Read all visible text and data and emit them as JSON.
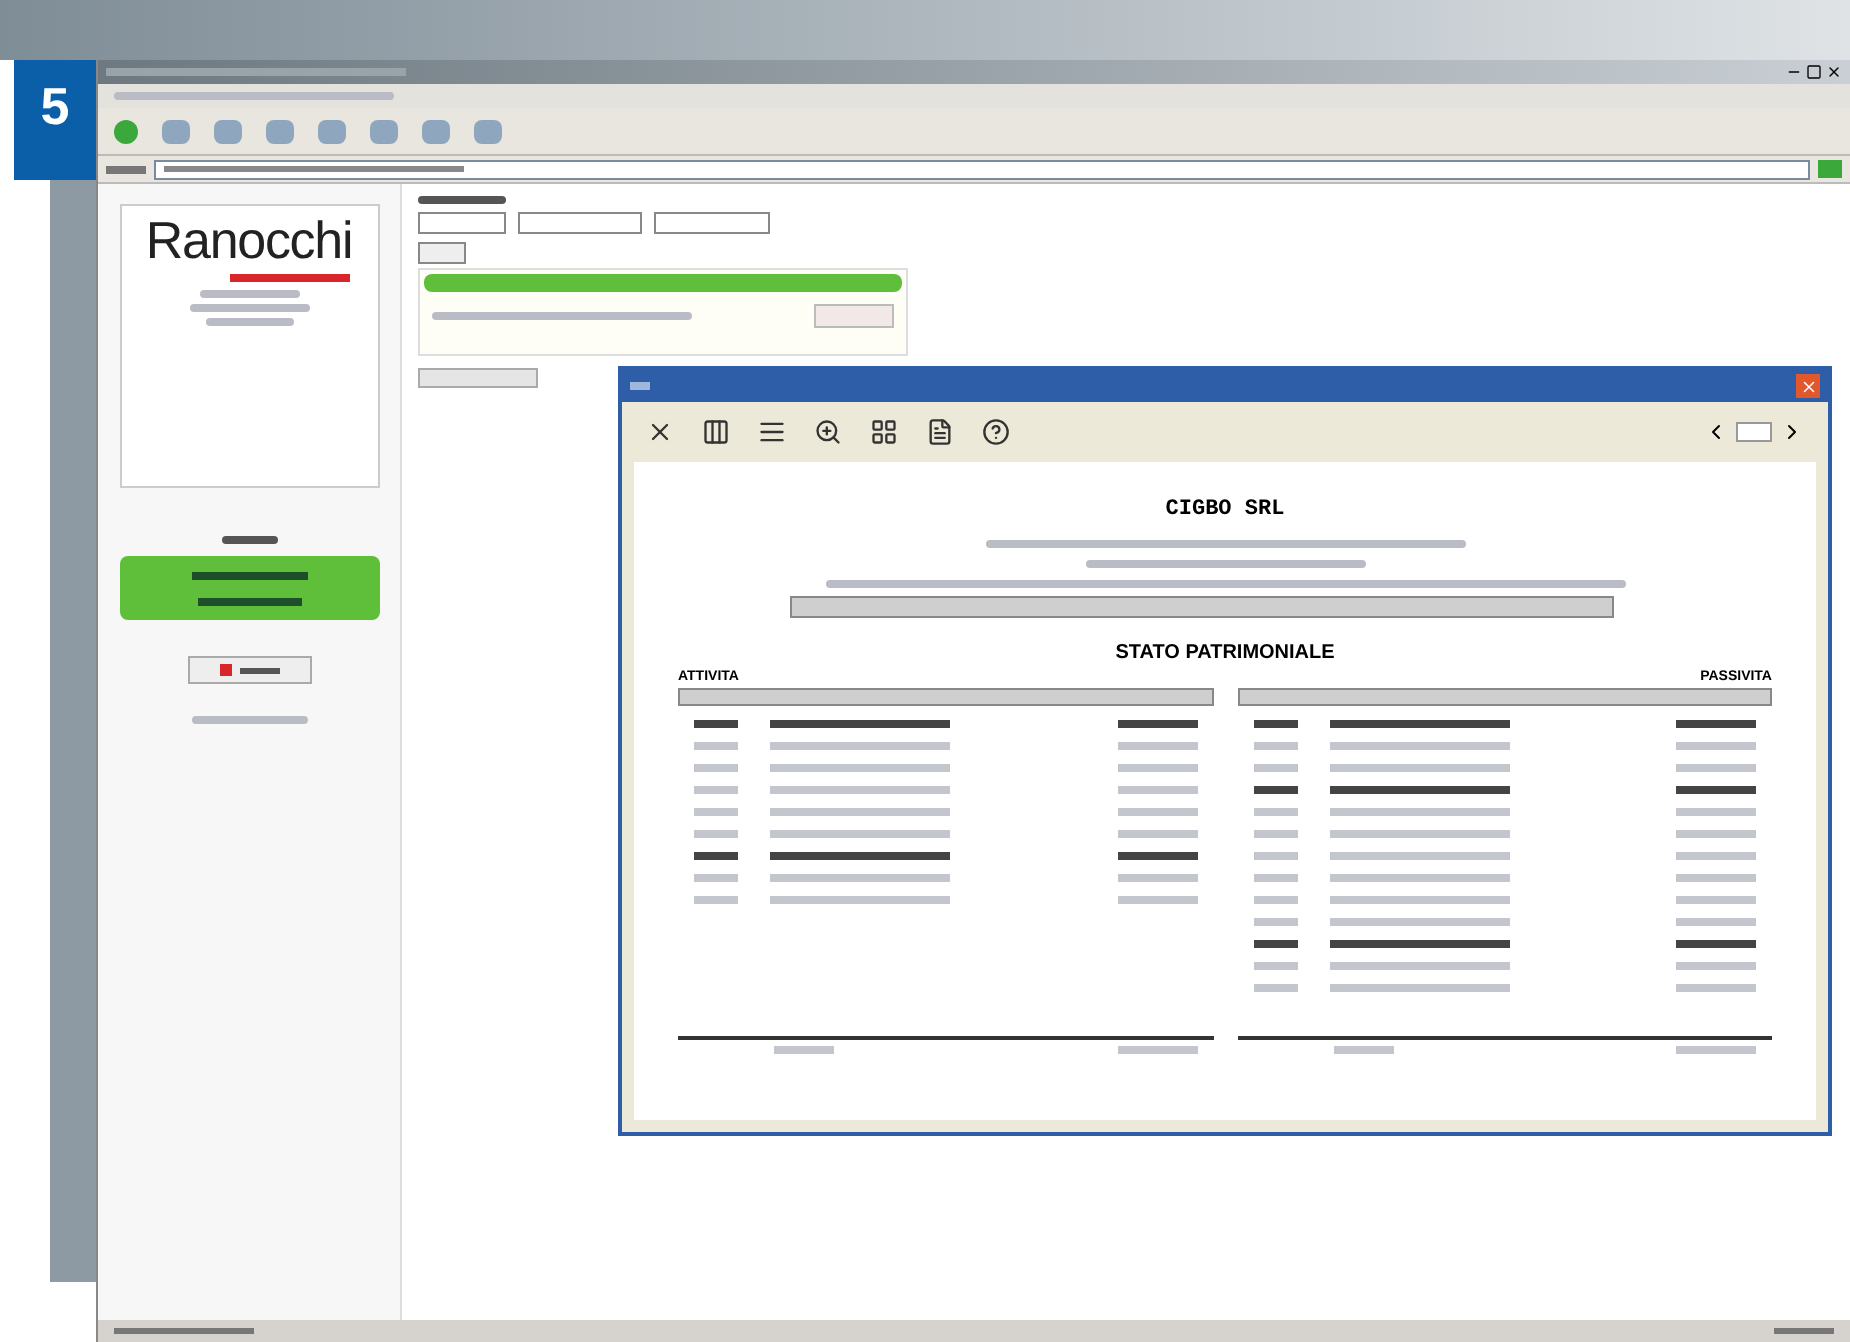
{
  "badge": "5",
  "logo": {
    "text": "Ranocchi"
  },
  "dialog": {
    "toolbar": [
      {
        "kind": "close"
      },
      {
        "kind": "columns"
      },
      {
        "kind": "lines"
      },
      {
        "kind": "zoom"
      },
      {
        "kind": "layout"
      },
      {
        "kind": "document"
      },
      {
        "kind": "help"
      }
    ]
  },
  "report": {
    "company": "CIGBO SRL",
    "section_title": "STATO PATRIMONIALE",
    "left_heading": "ATTIVITA",
    "right_heading": "PASSIVITA"
  }
}
